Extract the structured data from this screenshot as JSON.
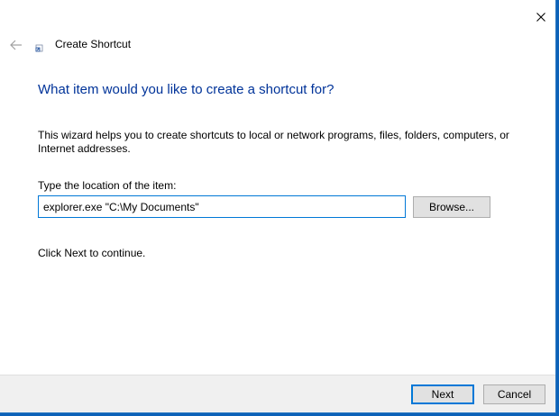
{
  "window": {
    "close_glyph": "×"
  },
  "header": {
    "back_icon": "back-arrow-icon",
    "app_icon": "shortcut-icon",
    "title": "Create Shortcut"
  },
  "content": {
    "main_instruction": "What item would you like to create a shortcut for?",
    "description": "This wizard helps you to create shortcuts to local or network programs, files, folders, computers, or Internet addresses.",
    "location_label": "Type the location of the item:",
    "location_value": "explorer.exe \"C:\\My Documents\"",
    "browse_label": "Browse...",
    "continue_text": "Click Next to continue."
  },
  "footer": {
    "next_label": "Next",
    "cancel_label": "Cancel"
  },
  "colors": {
    "accent": "#0078d7",
    "instruction": "#003399",
    "desktop": "#1a6fbf"
  }
}
